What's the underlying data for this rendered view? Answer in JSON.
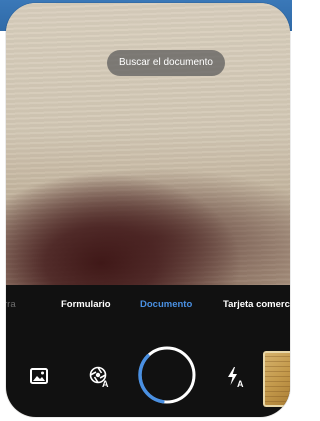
{
  "camera": {
    "toast_text": "Buscar el documento"
  },
  "modes": {
    "items": [
      {
        "label": "rra"
      },
      {
        "label": "Formulario"
      },
      {
        "label": "Documento"
      },
      {
        "label": "Tarjeta comerc"
      }
    ],
    "active": "Documento"
  },
  "controls": {
    "gallery_icon": "image-gallery-icon",
    "autocapture_icon": "auto-capture-icon",
    "shutter_icon": "shutter-ring-icon",
    "flash_icon": "flash-auto-icon",
    "thumbnail_icon": "document-thumbnail",
    "shutter_progress": 0.35
  },
  "colors": {
    "accent": "#4a90e2",
    "controls_bg": "#111111"
  }
}
